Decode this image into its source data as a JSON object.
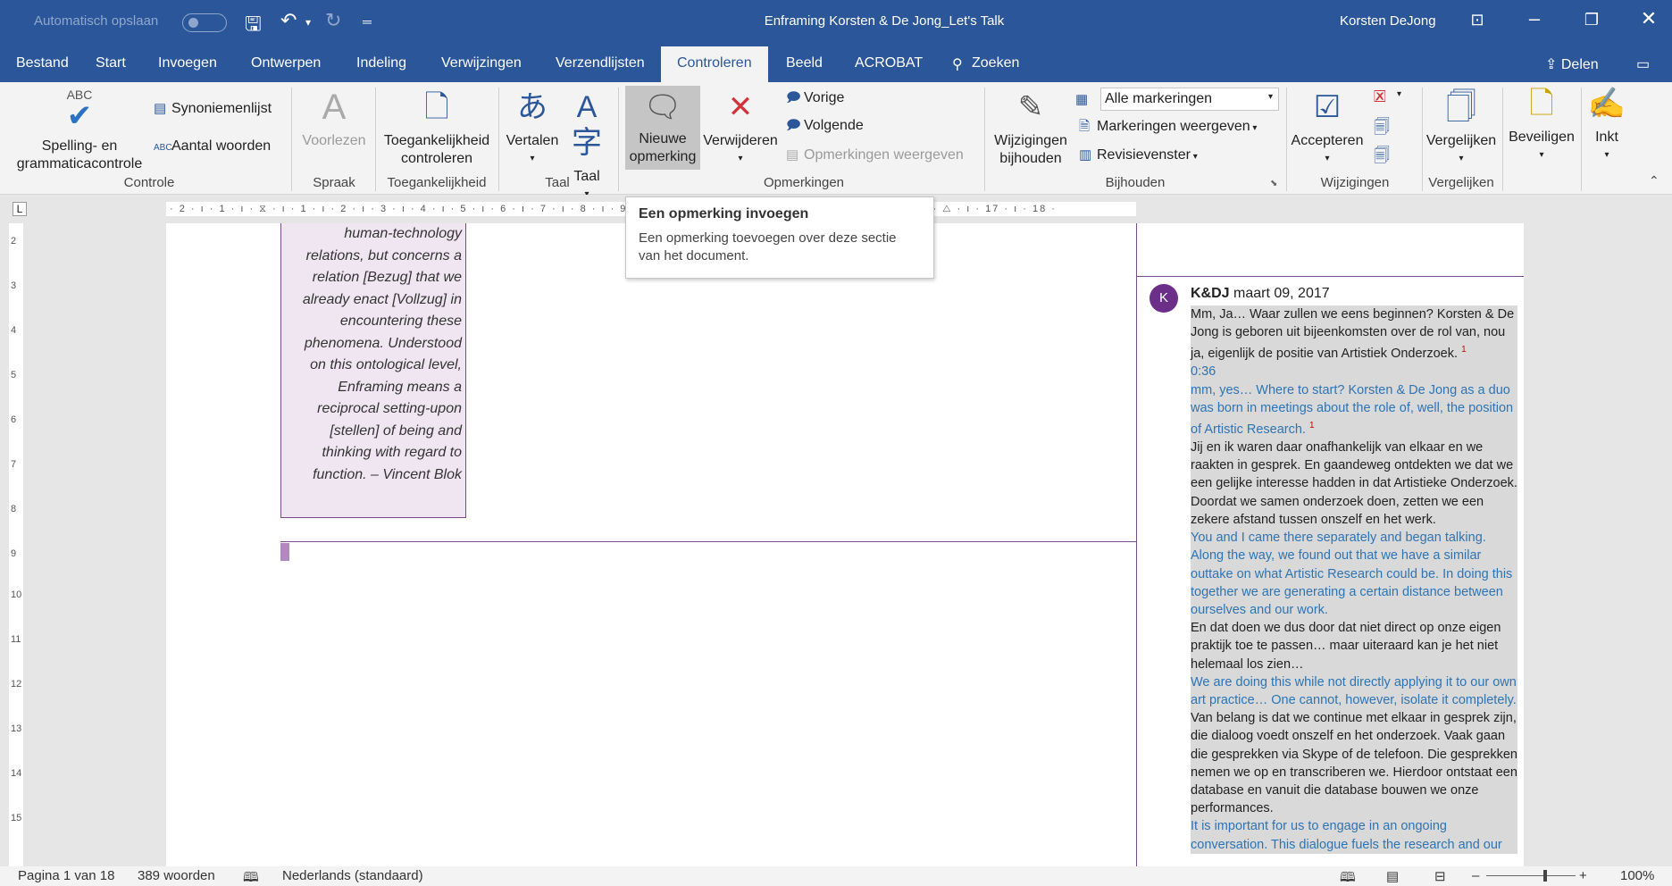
{
  "titlebar": {
    "autosave": "Automatisch opslaan",
    "title": "Enframing Korsten & De Jong_Let's Talk",
    "user": "Korsten DeJong"
  },
  "tabs": [
    "Bestand",
    "Start",
    "Invoegen",
    "Ontwerpen",
    "Indeling",
    "Verwijzingen",
    "Verzendlijsten",
    "Controleren",
    "Beeld",
    "ACROBAT",
    "Zoeken"
  ],
  "share": "Delen",
  "ribbon": {
    "spelling": [
      "Spelling- en",
      "grammaticacontrole"
    ],
    "abc": "ABC",
    "synonyms": "Synoniemenlijst",
    "wordcount": "Aantal woorden",
    "readaloud": "Voorlezen",
    "accessibility": [
      "Toegankelijkheid",
      "controleren"
    ],
    "translate": "Vertalen",
    "language": "Taal",
    "new_comment": [
      "Nieuwe",
      "opmerking"
    ],
    "delete": "Verwijderen",
    "previous": "Vorige",
    "next": "Volgende",
    "show_comments": "Opmerkingen weergeven",
    "track_changes": [
      "Wijzigingen",
      "bijhouden"
    ],
    "markup_combo": "Alle markeringen",
    "show_markup": "Markeringen weergeven",
    "review_pane": "Revisievenster",
    "accept": "Accepteren",
    "compare": "Vergelijken",
    "protect": "Beveiligen",
    "ink": "Inkt",
    "groups": {
      "controle": "Controle",
      "spraak": "Spraak",
      "toegankelijkheid": "Toegankelijkheid",
      "taal": "Taal",
      "opmerkingen": "Opmerkingen",
      "bijhouden": "Bijhouden",
      "wijzigingen": "Wijzigingen",
      "vergelijken": "Vergelijken"
    }
  },
  "tooltip": {
    "title": "Een opmerking invoegen",
    "body": "Een opmerking toevoegen over deze sectie van het document."
  },
  "document": {
    "quote_lines": [
      "human-technology",
      "relations, but concerns a",
      "relation [Bezug] that we",
      "already enact [Vollzug] in",
      "encountering these",
      "phenomena. Understood",
      "on this ontological level,",
      "Enframing means a",
      "reciprocal setting-upon",
      "[stellen] of being and",
      "thinking with regard to",
      "function. – Vincent Blok"
    ]
  },
  "comment": {
    "avatar": "K",
    "author": "K&DJ",
    "date": "maart 09, 2017",
    "p1": "Mm, Ja… Waar zullen we eens beginnen? Korsten & De Jong is geboren uit bijeenkomsten over de rol van, nou ja, eigenlijk de positie van Artistiek Onderzoek.",
    "fn": "1",
    "time": "0:36",
    "p2": "mm, yes… Where to start? Korsten & De Jong as a duo was born in meetings about the role of, well, the position of Artistic Research.",
    "p3": "Jij en ik waren daar onafhankelijk van elkaar en we raakten in gesprek. En gaandeweg ontdekten we dat we een gelijke interesse hadden in dat Artistieke Onderzoek. Doordat we samen onderzoek doen, zetten we een zekere afstand tussen onszelf en het werk.",
    "p4": "You and I came there separately and began talking. Along the way, we found out that we have a similar outtake on what Artistic Research could be. In doing this together we are generating a certain distance between ourselves and our work.",
    "p5": "En dat doen we dus door dat niet direct op onze eigen praktijk toe te passen… maar uiteraard kan je het niet helemaal los zien…",
    "p6": "We are doing this while not directly applying it to our own art practice… One cannot, however, isolate it completely.",
    "p7": "Van belang is dat we continue met elkaar in gesprek zijn, die dialoog voedt onszelf en het onderzoek. Vaak gaan die gesprekken via Skype of de telefoon. Die gesprekken nemen we op en transcriberen we. Hierdoor ontstaat een database en vanuit die database bouwen we onze performances.",
    "p8": "It is important for us to engage in an ongoing conversation. This dialogue fuels the research and our"
  },
  "statusbar": {
    "page": "Pagina 1 van 18",
    "words": "389 woorden",
    "language": "Nederlands (standaard)",
    "zoom": "100%"
  },
  "ruler_text": "· 2 · ı · 1 · ı · ⧖ · ı · 1 · ı · 2 · ı · 3 · ı · 4 · ı · 5 · ı · 6 · ı · 7 · ı · 8 · ı · 9 · ı · 10 · ı · 11 · ı · 12 · ı · 13 · ı · 14 · ı · 15 · ı · △ · ı · 17 · ı · 18 ·"
}
